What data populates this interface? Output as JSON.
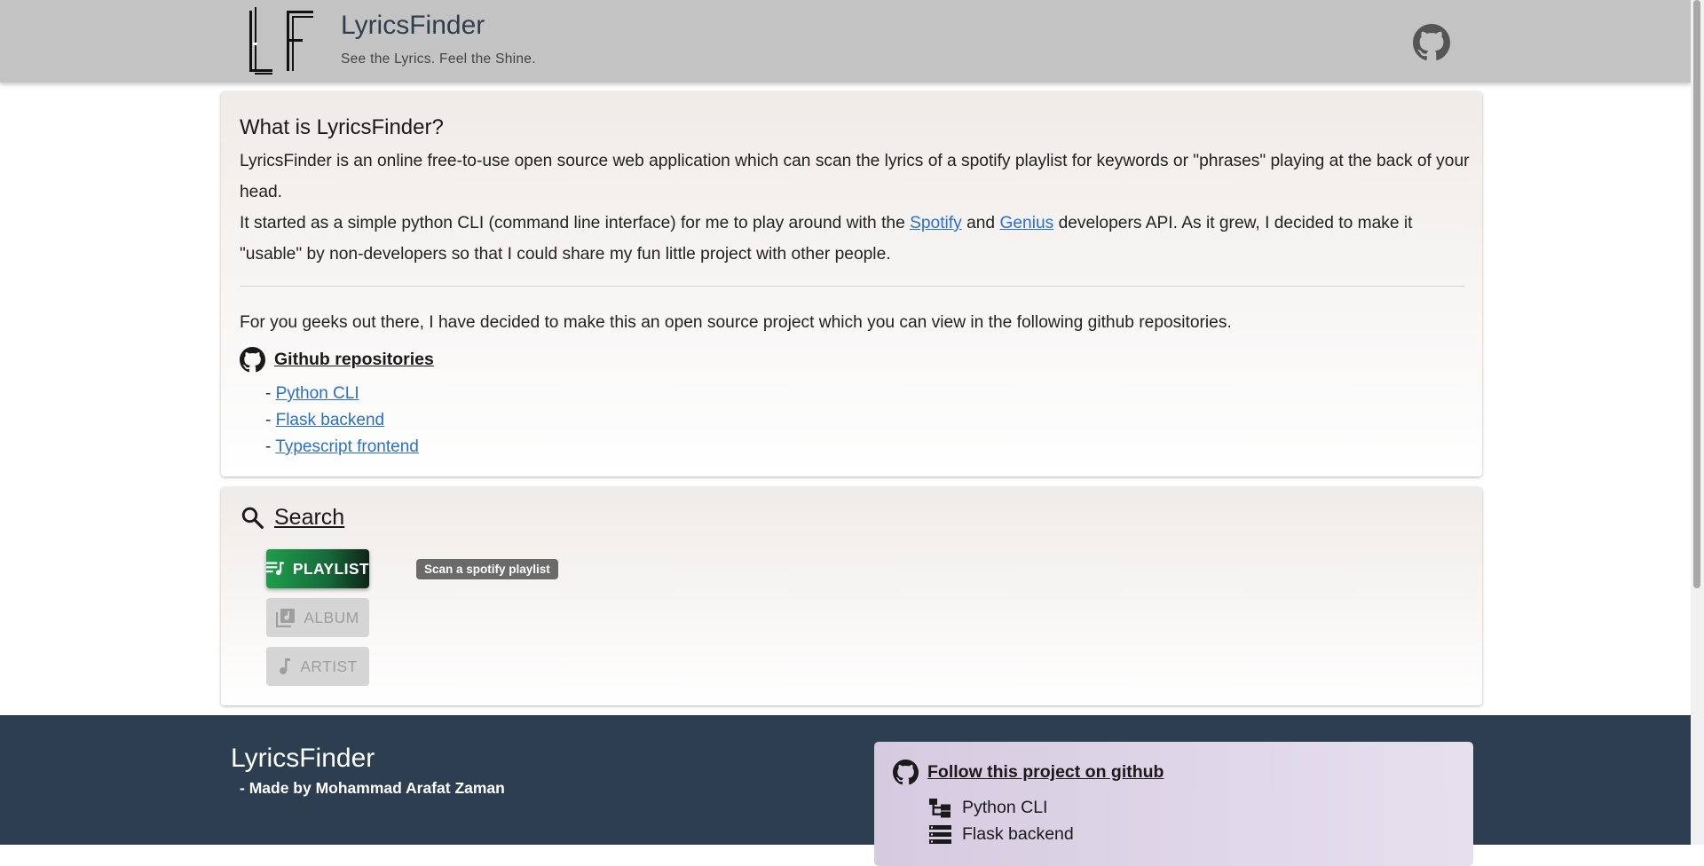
{
  "header": {
    "title": "LyricsFinder",
    "tagline": "See the Lyrics. Feel the Shine.",
    "logo_icon": "lf-logo-icon",
    "github_icon": "github-icon"
  },
  "about": {
    "heading": "What is LyricsFinder?",
    "p1": "LyricsFinder is an online free-to-use open source web application which can scan the lyrics of a spotify playlist for keywords or \"phrases\" playing at the back of your head.",
    "p2_before": "It started as a simple python CLI (command line interface) for me to play around with the ",
    "p2_link1": "Spotify",
    "p2_mid": " and ",
    "p2_link2": "Genius",
    "p2_after": " developers API. As it grew, I decided to make it \"usable\" by non-developers so that I could share my fun little project with other people.",
    "p3": "For you geeks out there, I have decided to make this an open source project which you can view in the following github repositories.",
    "repos_heading": "Github repositories",
    "repos": [
      {
        "prefix": "- ",
        "label": "Python CLI"
      },
      {
        "prefix": "- ",
        "label": "Flask backend"
      },
      {
        "prefix": "- ",
        "label": "Typescript frontend"
      }
    ]
  },
  "search": {
    "heading": "Search",
    "buttons": {
      "playlist": "PLAYLIST",
      "album": "ALBUM",
      "artist": "ARTIST"
    },
    "tooltip": "Scan a spotify playlist",
    "colors": {
      "playlist_start": "#1e9e4c",
      "playlist_end": "#0f2418"
    }
  },
  "footer": {
    "title": "LyricsFinder",
    "credit": "- Made by Mohammad Arafat Zaman",
    "follow_heading": "Follow this project on github",
    "items": [
      "Python CLI",
      "Flask backend"
    ],
    "background": "#2d3e50"
  }
}
